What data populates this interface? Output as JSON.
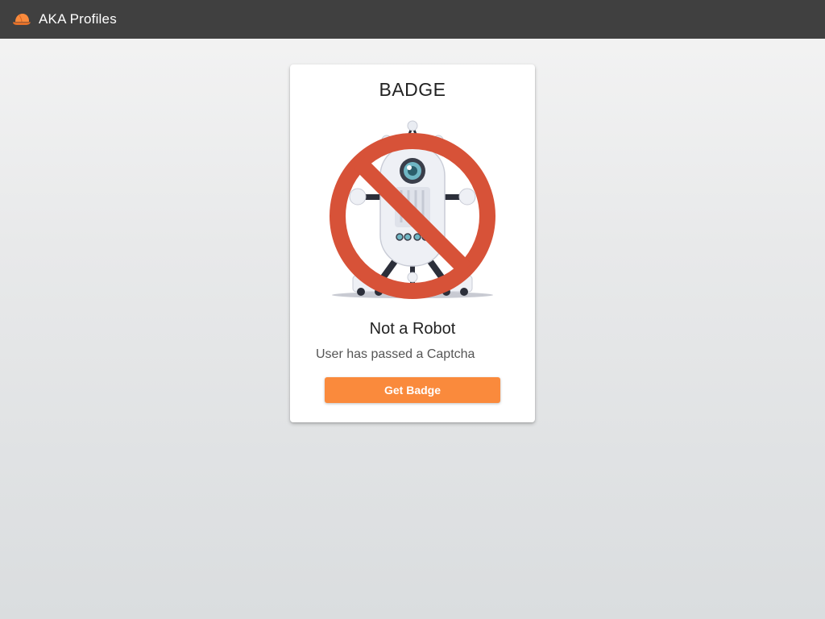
{
  "header": {
    "title": "AKA Profiles",
    "icon": "cap-logo-icon",
    "background": "#404040"
  },
  "badge_card": {
    "heading": "BADGE",
    "illustration": "no-robot-icon",
    "name": "Not a Robot",
    "description": "User has passed a Captcha",
    "button_label": "Get Badge",
    "accent_color": "#fa8a3c",
    "prohibition_color": "#d75238"
  }
}
